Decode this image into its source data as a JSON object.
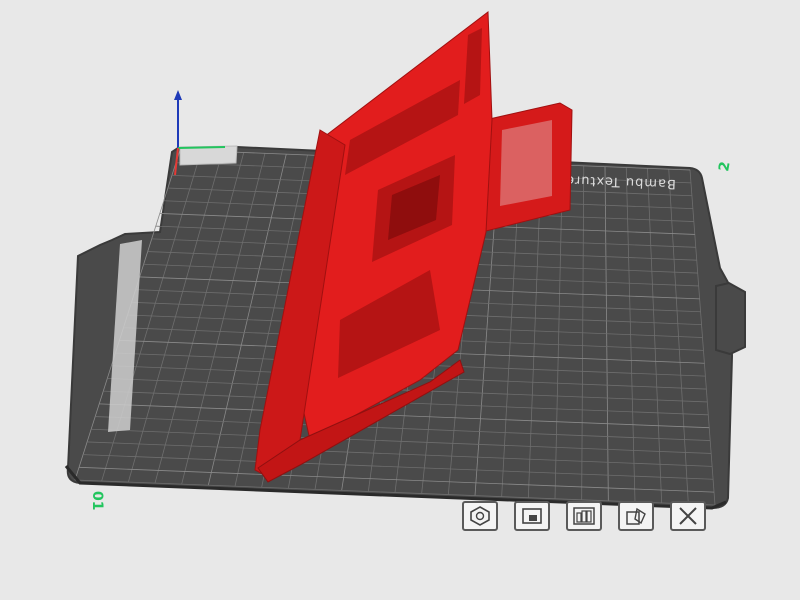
{
  "viewport": {
    "background": "#e8e8e8",
    "plate_color": "#4a4a4a",
    "grid_color": "#707070",
    "model_color": "#e21d1d"
  },
  "plate": {
    "label": "Bambu Textured PEI Plate",
    "number_front": "01",
    "number_right": "2"
  },
  "axes": {
    "x_color": "#e53935",
    "y_color": "#22c55e",
    "z_color": "#1e3ab8"
  },
  "toolbar": {
    "buttons": [
      {
        "id": "hex",
        "icon": "hexagon-nut-icon"
      },
      {
        "id": "lock",
        "icon": "lock-icon"
      },
      {
        "id": "layout",
        "icon": "layout-grid-icon"
      },
      {
        "id": "paint",
        "icon": "paint-bucket-icon"
      },
      {
        "id": "close",
        "icon": "close-icon"
      }
    ]
  }
}
